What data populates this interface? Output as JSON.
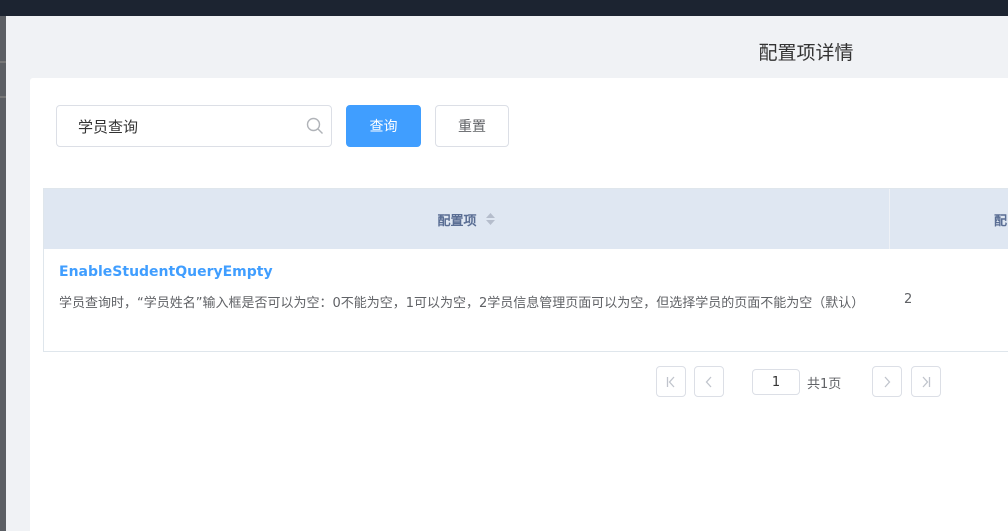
{
  "dialog": {
    "title": "配置项详情"
  },
  "search": {
    "value": "学员查询",
    "query_label": "查询",
    "reset_label": "重置"
  },
  "table": {
    "columns": [
      {
        "label": "配置项",
        "sortable": true
      },
      {
        "label": "配"
      }
    ],
    "rows": [
      {
        "key": "EnableStudentQueryEmpty",
        "description": "学员查询时，“学员姓名”输入框是否可以为空：0不能为空，1可以为空，2学员信息管理页面可以为空，但选择学员的页面不能为空（默认）",
        "value": "2"
      }
    ]
  },
  "pagination": {
    "current_page": "1",
    "total_label": "共1页"
  },
  "icons": {
    "search": "search-icon",
    "sort": "sort-icon",
    "first": "first-page-icon",
    "prev": "chevron-left-icon",
    "next": "chevron-right-icon",
    "last": "last-page-icon"
  },
  "colors": {
    "primary": "#409eff",
    "header_bg": "#dfe7f2",
    "header_text": "#5a6e94",
    "overlay": "#1c2431"
  }
}
